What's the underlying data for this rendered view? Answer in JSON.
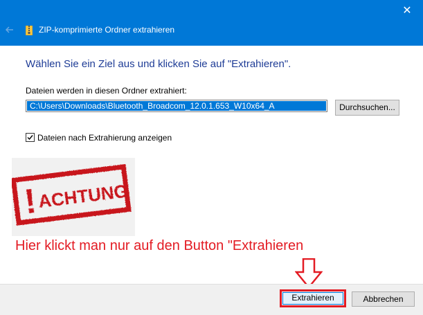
{
  "window": {
    "title": "ZIP-komprimierte Ordner extrahieren",
    "close_glyph": "✕",
    "accent_color": "#0078d7"
  },
  "dialog": {
    "instruction": "Wählen Sie ein Ziel aus und klicken Sie auf \"Extrahieren\".",
    "path_label": "Dateien werden in diesen Ordner extrahiert:",
    "path_value": "C:\\Users\\Downloads\\Bluetooth_Broadcom_12.0.1.653_W10x64_A",
    "browse_label": "Durchsuchen...",
    "show_files_label": "Dateien nach Extrahierung anzeigen",
    "show_files_checked": true
  },
  "overlay": {
    "stamp_text": "ACHTUNG",
    "stamp_mark": "!",
    "annotation": "Hier klickt man nur auf den Button \"Extrahieren",
    "annotation_color": "#e31b23"
  },
  "footer": {
    "extract_label": "Extrahieren",
    "cancel_label": "Abbrechen"
  },
  "icons": {
    "back": "back-arrow-icon",
    "zip": "zip-folder-icon",
    "close": "close-icon",
    "check": "checkmark-icon",
    "pointer": "down-arrow-icon"
  }
}
